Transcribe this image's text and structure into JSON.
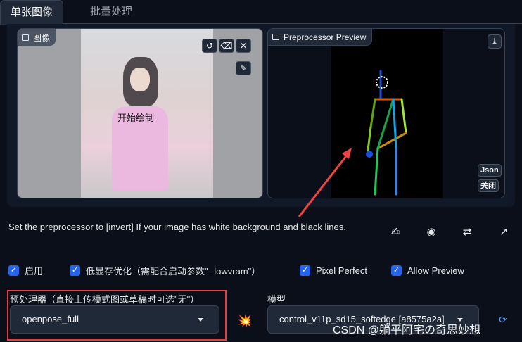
{
  "tabs": {
    "single": "单张图像",
    "batch": "批量处理"
  },
  "input_panel": {
    "label": "图像",
    "overlay_text": "开始绘制",
    "tools": [
      "undo-icon",
      "eraser-icon",
      "close-icon",
      "brush-icon"
    ]
  },
  "preview_panel": {
    "label": "Preprocessor Preview",
    "json_btn": "Json",
    "close_btn": "关闭",
    "download_icon": "download-icon"
  },
  "hint_text": "Set the preprocessor to [invert] If your image has white background and black lines.",
  "action_icons": [
    "memo-icon",
    "camera-icon",
    "swap-icon",
    "send-up-icon"
  ],
  "checkboxes": [
    {
      "label": "启用",
      "checked": true
    },
    {
      "label": "低显存优化（需配合启动参数\"--lowvram\"）",
      "checked": true
    },
    {
      "label": "Pixel Perfect",
      "checked": true
    },
    {
      "label": "Allow Preview",
      "checked": true
    }
  ],
  "preprocessor": {
    "label": "预处理器（直接上传模式图或草稿时可选\"无\"）",
    "value": "openpose_full"
  },
  "model": {
    "label": "模型",
    "value": "control_v11p_sd15_softedge [a8575a2a]"
  },
  "watermark": "CSDN @躺平阿宅の奇思妙想",
  "colors": {
    "accent": "#2563eb",
    "highlight": "#e53e3e"
  }
}
